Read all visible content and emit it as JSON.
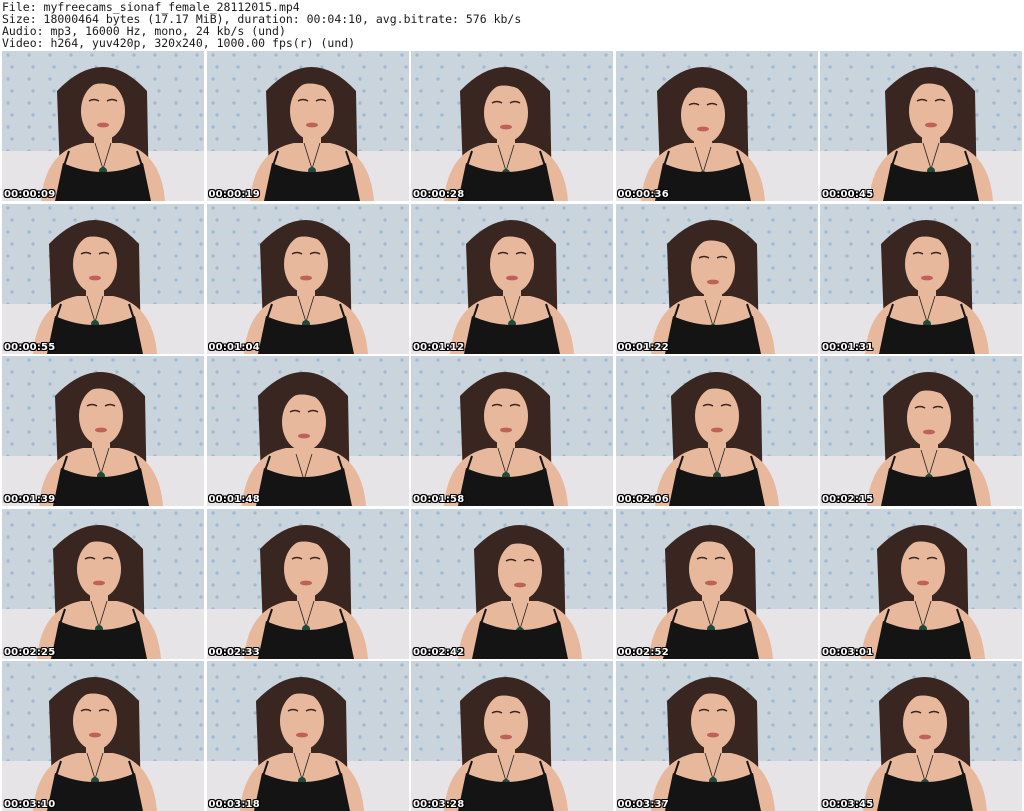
{
  "header": {
    "file_line": "File: myfreecams_sionaf_female_28112015.mp4",
    "size_line": "Size: 18000464 bytes (17.17 MiB), duration: 00:04:10, avg.bitrate: 576 kb/s",
    "audio_line": "Audio: mp3, 16000 Hz, mono, 24 kb/s (und)",
    "video_line": "Video: h264, yuv420p, 320x240, 1000.00 fps(r) (und)"
  },
  "colors": {
    "background_wall": "#c9d4dc",
    "wall_dots": "#8fb0d0",
    "sofa": "#e6e4e6",
    "skin": "#e8b89c",
    "hair": "#3a2620",
    "top": "#141414",
    "lips": "#c0605a",
    "pendant": "#1f4a3a"
  },
  "thumbnails": [
    {
      "time": "00:00:09"
    },
    {
      "time": "00:00:19"
    },
    {
      "time": "00:00:28"
    },
    {
      "time": "00:00:36"
    },
    {
      "time": "00:00:45"
    },
    {
      "time": "00:00:55"
    },
    {
      "time": "00:01:04"
    },
    {
      "time": "00:01:12"
    },
    {
      "time": "00:01:22"
    },
    {
      "time": "00:01:31"
    },
    {
      "time": "00:01:39"
    },
    {
      "time": "00:01:48"
    },
    {
      "time": "00:01:58"
    },
    {
      "time": "00:02:06"
    },
    {
      "time": "00:02:15"
    },
    {
      "time": "00:02:25"
    },
    {
      "time": "00:02:33"
    },
    {
      "time": "00:02:42"
    },
    {
      "time": "00:02:52"
    },
    {
      "time": "00:03:01"
    },
    {
      "time": "00:03:10"
    },
    {
      "time": "00:03:18"
    },
    {
      "time": "00:03:28"
    },
    {
      "time": "00:03:37"
    },
    {
      "time": "00:03:45"
    }
  ]
}
